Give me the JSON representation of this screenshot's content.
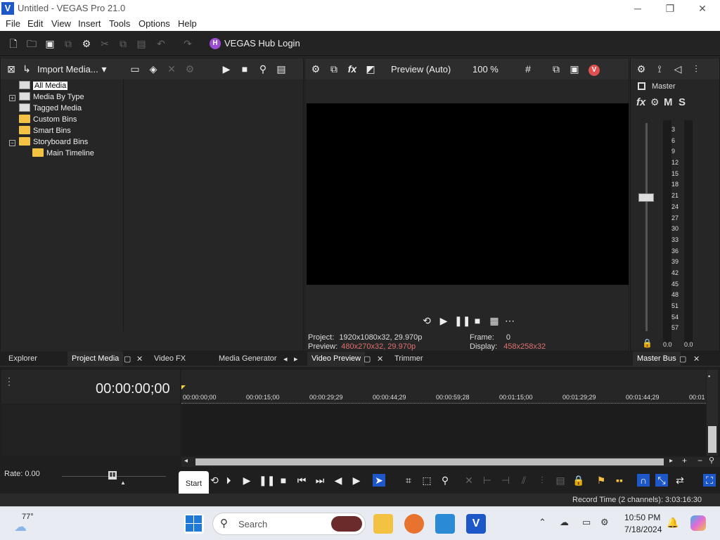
{
  "window": {
    "title": "Untitled - VEGAS Pro 21.0",
    "logo": "V",
    "min": "─",
    "max": "❐",
    "close": "✕"
  },
  "menu": [
    "File",
    "Edit",
    "View",
    "Insert",
    "Tools",
    "Options",
    "Help"
  ],
  "toolbar": {
    "hub_label": "VEGAS Hub Login",
    "hub_icon": "H"
  },
  "explorer": {
    "import_label": "Import Media...",
    "tree": [
      {
        "label": "All Media",
        "selected": true
      },
      {
        "label": "Media By Type"
      },
      {
        "label": "Tagged Media"
      },
      {
        "label": "Custom Bins"
      },
      {
        "label": "Smart Bins"
      },
      {
        "label": "Storyboard Bins"
      },
      {
        "label": "Main Timeline"
      }
    ],
    "tabs": [
      "Explorer",
      "Project Media",
      "Video FX",
      "Media Generator"
    ]
  },
  "preview": {
    "mode": "Preview (Auto)",
    "zoom": "100 %",
    "project_label": "Project:",
    "project_value": "1920x1080x32, 29.970p",
    "preview_label": "Preview:",
    "preview_value": "480x270x32, 29.970p",
    "frame_label": "Frame:",
    "frame_value": "0",
    "display_label": "Display:",
    "display_value": "458x258x32",
    "tabs": [
      "Video Preview",
      "Trimmer"
    ]
  },
  "master": {
    "title": "Master",
    "fx": "fx",
    "m": "M",
    "s": "S",
    "scale": [
      "3",
      "6",
      "9",
      "12",
      "15",
      "18",
      "21",
      "24",
      "27",
      "30",
      "33",
      "36",
      "39",
      "42",
      "45",
      "48",
      "51",
      "54",
      "57"
    ],
    "left_db": "0.0",
    "right_db": "0.0",
    "tab": "Master Bus"
  },
  "timeline": {
    "timecode": "00:00:00;00",
    "ruler": [
      "00:00:00;00",
      "00:00:15;00",
      "00:00:29;29",
      "00:00:44;29",
      "00:00:59;28",
      "00:01:15;00",
      "00:01:29;29",
      "00:01:44;29",
      "00:01"
    ],
    "rate": "Rate: 0.00",
    "tooltip": "Start"
  },
  "status": {
    "record_time": "Record Time (2 channels): 3:03:16:30"
  },
  "taskbar": {
    "weather": "77°",
    "search_placeholder": "Search",
    "time": "10:50 PM",
    "date": "7/18/2024"
  },
  "colors": {
    "accent": "#1e57c8",
    "highlight": "#e05050",
    "folder": "#f3c242"
  }
}
